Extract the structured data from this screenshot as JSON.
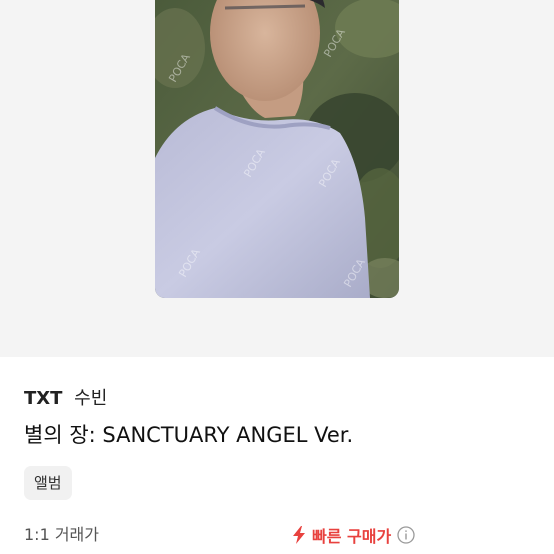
{
  "product": {
    "artist": "TXT",
    "member": "수빈",
    "album_title": "별의 장: SANCTUARY ANGEL Ver.",
    "category_chip": "앨범"
  },
  "trade": {
    "type_label": "1:1 거래가",
    "quick_buy_label": "빠른 구매가"
  },
  "image": {
    "watermark_text": "POCA"
  },
  "colors": {
    "accent": "#e8413e",
    "stage_background": "#f4f4f4",
    "chip_background": "#f1f1f1"
  },
  "icons": {
    "quick_buy": "lightning-bolt-icon",
    "info": "info-circle-icon"
  }
}
